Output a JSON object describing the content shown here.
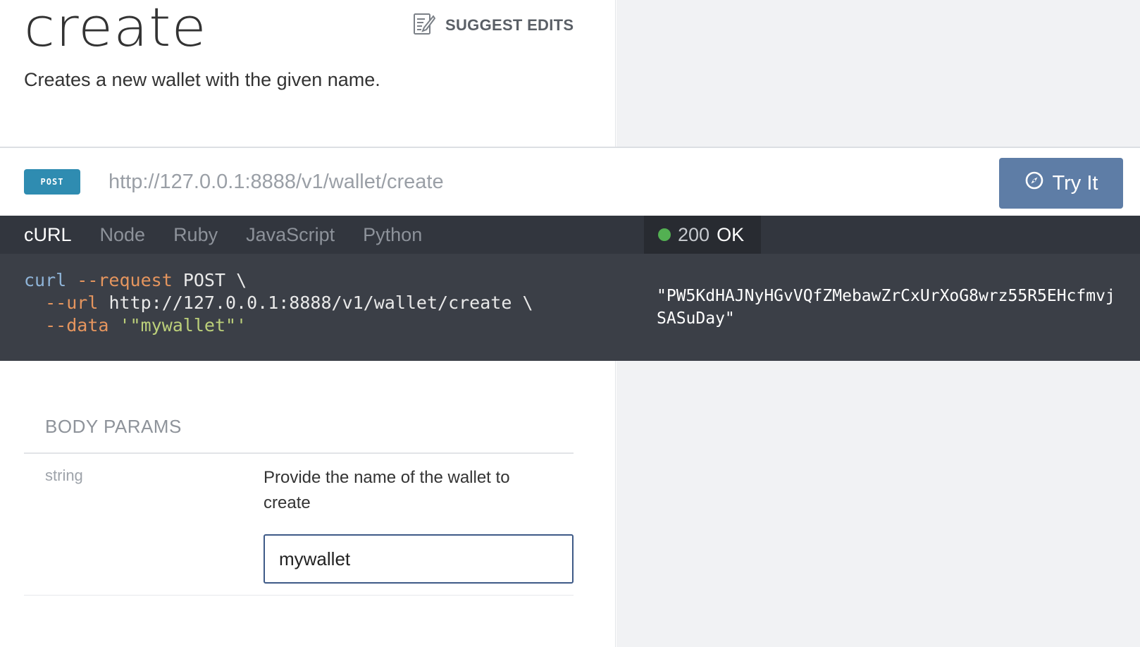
{
  "header": {
    "title": "create",
    "suggest_edits_label": "SUGGEST EDITS",
    "description": "Creates a new wallet with the given name."
  },
  "endpoint": {
    "method": "POST",
    "url": "http://127.0.0.1:8888/v1/wallet/create",
    "try_label": "Try It"
  },
  "code_tabs": [
    {
      "label": "cURL",
      "active": true
    },
    {
      "label": "Node",
      "active": false
    },
    {
      "label": "Ruby",
      "active": false
    },
    {
      "label": "JavaScript",
      "active": false
    },
    {
      "label": "Python",
      "active": false
    }
  ],
  "code_sample": {
    "line1": {
      "cmd": "curl",
      "flag": "--request",
      "value": "POST",
      "cont": "\\"
    },
    "line2": {
      "flag": "--url",
      "value": "http://127.0.0.1:8888/v1/wallet/create",
      "cont": "\\"
    },
    "line3": {
      "flag": "--data",
      "value": "'\"mywallet\"'"
    }
  },
  "response": {
    "status_code": "200",
    "status_text": "OK",
    "status_color": "#53b052",
    "body": "\"PW5KdHAJNyHGvVQfZMebawZrCxUrXoG8wrz55R5EHcfmvjSASuDay\""
  },
  "body_params": {
    "heading": "BODY PARAMS",
    "params": [
      {
        "type": "string",
        "description": "Provide the name of the wallet to create",
        "value": "mywallet"
      }
    ]
  },
  "colors": {
    "method_badge": "#2f8cb1",
    "try_button": "#5e7da6",
    "code_bg": "#3b3f47",
    "tab_bar_bg": "#32363e"
  },
  "icons": {
    "suggest_edits": "edit-document-icon",
    "try_it": "compass-icon"
  }
}
